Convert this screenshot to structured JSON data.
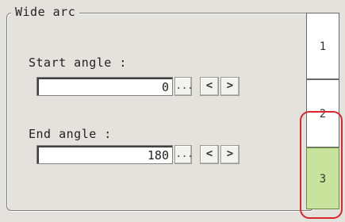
{
  "group": {
    "title": "Wide arc"
  },
  "start_angle": {
    "label": "Start angle :",
    "value": "0"
  },
  "end_angle": {
    "label": "End angle :",
    "value": "180"
  },
  "buttons": {
    "ellipsis": "...",
    "decrement": "<",
    "increment": ">"
  },
  "tabs": [
    {
      "label": "1"
    },
    {
      "label": "2"
    },
    {
      "label": "3",
      "selected": true
    }
  ],
  "colors": {
    "selected_tab": "#c8e39c",
    "highlight": "#d9252b",
    "background": "#e3e2dc"
  }
}
